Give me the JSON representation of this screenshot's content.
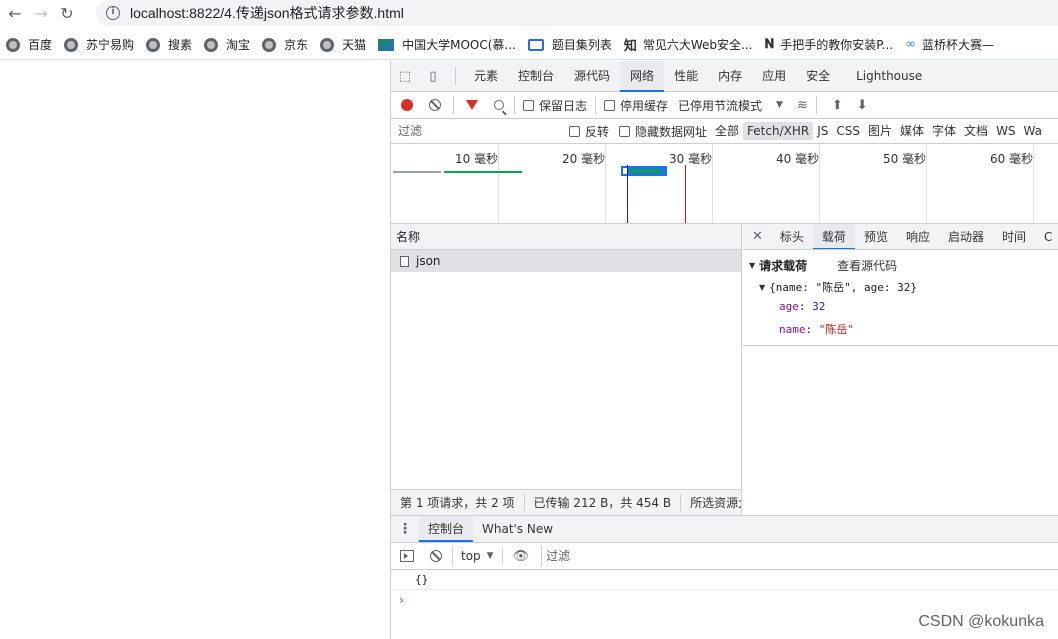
{
  "browser": {
    "back_icon": "arrow-left-icon",
    "forward_icon": "arrow-right-icon",
    "reload_icon": "reload-icon",
    "url": "localhost:8822/4.传递json格式请求参数.html"
  },
  "bookmarks": [
    {
      "label": "百度"
    },
    {
      "label": "苏宁易购"
    },
    {
      "label": "搜素"
    },
    {
      "label": "淘宝"
    },
    {
      "label": "京东"
    },
    {
      "label": "天猫"
    },
    {
      "label": "中国大学MOOC(慕..."
    },
    {
      "label": "题目集列表"
    },
    {
      "label": "常见六大Web安全..."
    },
    {
      "label": "手把手的教你安装P..."
    },
    {
      "label": "蓝桥杯大赛—"
    }
  ],
  "devtools": {
    "tabs": [
      "元素",
      "控制台",
      "源代码",
      "网络",
      "性能",
      "内存",
      "应用",
      "安全",
      "Lighthouse"
    ],
    "active_tab": "网络",
    "toolbar": {
      "preserve_log": "保留日志",
      "disable_cache": "停用缓存",
      "throttling": "已停用节流模式"
    },
    "filter": {
      "placeholder": "过滤",
      "invert": "反转",
      "hide_data_urls": "隐藏数据网址",
      "types": [
        "全部",
        "Fetch/XHR",
        "JS",
        "CSS",
        "图片",
        "媒体",
        "字体",
        "文档",
        "WS",
        "Wa"
      ],
      "active_type": "Fetch/XHR"
    },
    "timeline": {
      "ticks": [
        "10 毫秒",
        "20 毫秒",
        "30 毫秒",
        "40 毫秒",
        "50 毫秒",
        "60 毫秒"
      ]
    },
    "requests": {
      "column_name": "名称",
      "rows": [
        {
          "name": "json"
        }
      ]
    },
    "status": {
      "requests": "第 1 项请求，共 2 项",
      "transferred": "已传输 212 B，共 454 B",
      "resources": "所选资源大小"
    },
    "detail": {
      "tabs": [
        "标头",
        "载荷",
        "预览",
        "响应",
        "启动器",
        "时间",
        "C"
      ],
      "active_tab": "载荷",
      "payload_title": "请求载荷",
      "view_source": "查看源代码",
      "object_summary": "{name: \"陈岳\", age: 32}",
      "props": [
        {
          "key": "age",
          "value": "32",
          "kind": "number"
        },
        {
          "key": "name",
          "value": "\"陈岳\"",
          "kind": "string"
        }
      ]
    },
    "drawer": {
      "tabs": [
        "控制台",
        "What's New"
      ],
      "active_tab": "控制台",
      "context": "top",
      "filter_placeholder": "过滤",
      "output": "{}",
      "prompt": "›"
    }
  },
  "watermark": "CSDN @kokunka",
  "colors": {
    "accent": "#1a73e8",
    "record": "#d93025",
    "waterfall_green": "#0f9d58"
  }
}
